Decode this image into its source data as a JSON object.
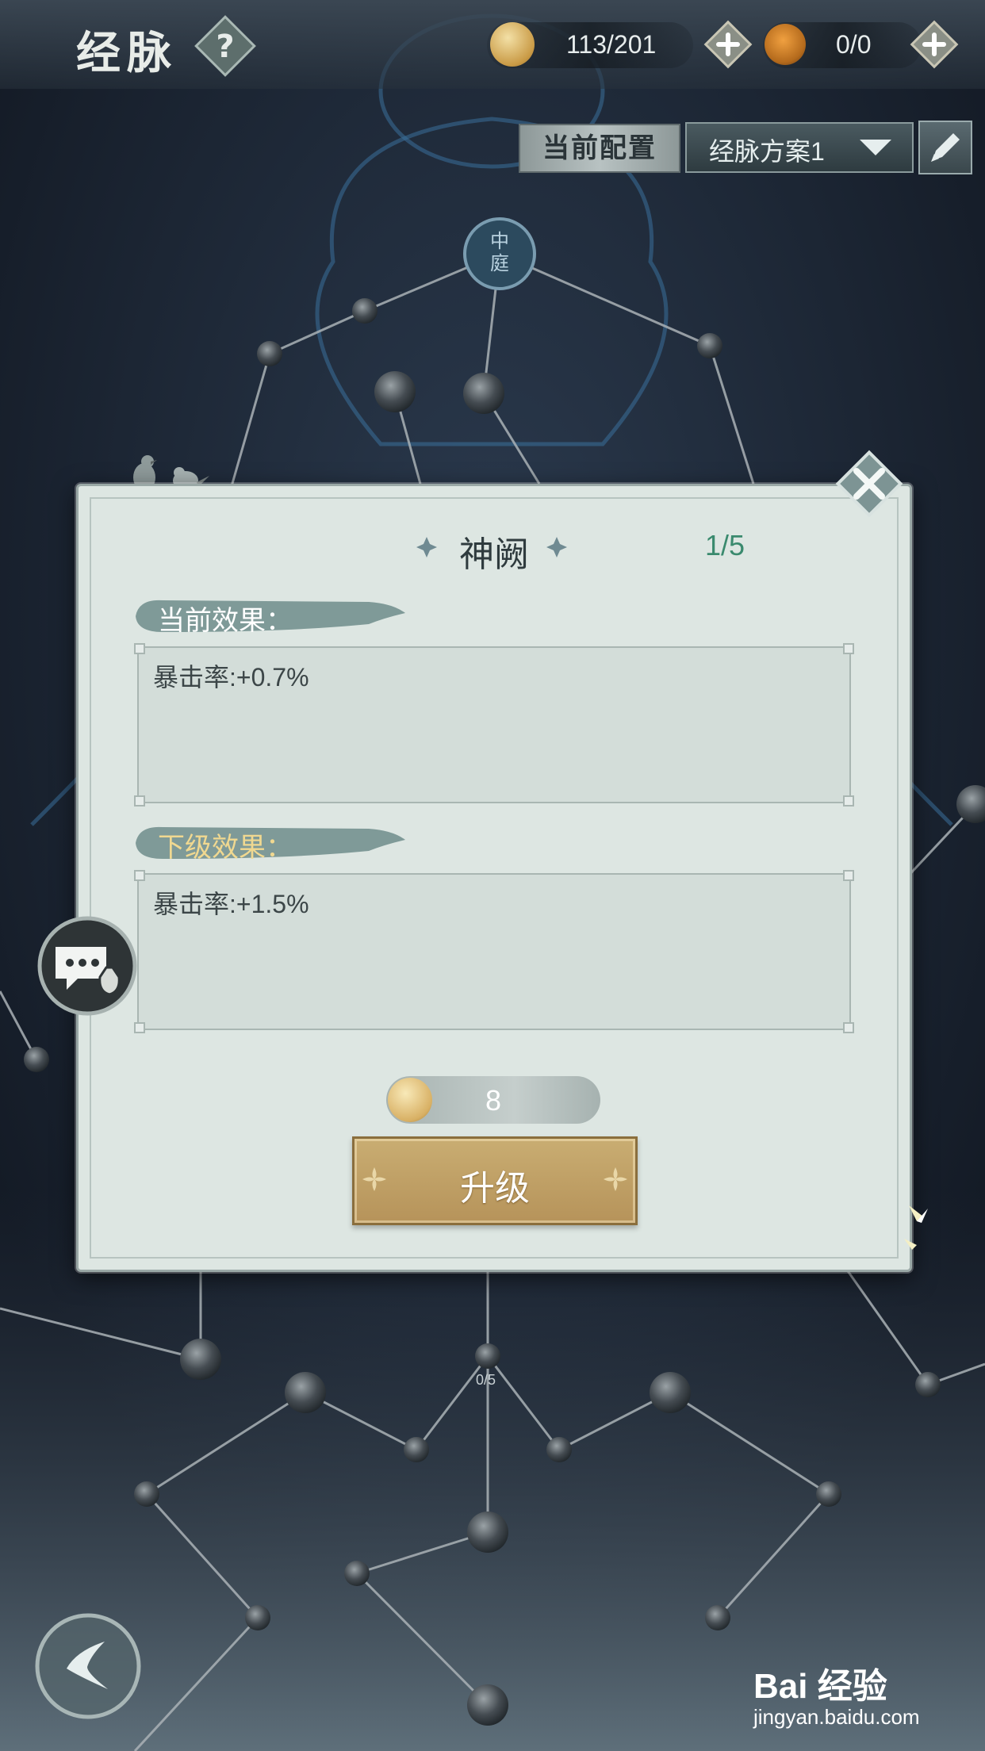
{
  "header": {
    "title": "经脉",
    "help_symbol": "?",
    "qi": {
      "icon_text": "元气",
      "value": "113/201"
    },
    "coin": {
      "value": "0/0"
    }
  },
  "config": {
    "label": "当前配置",
    "selected_plan": "经脉方案1"
  },
  "map": {
    "top_node_text": "中庭",
    "node_progress_label": "0/5"
  },
  "popup": {
    "skill_name": "神阙",
    "level": "1/5",
    "current_effect_label": "当前效果：",
    "current_effect_text": "暴击率:+0.7%",
    "next_effect_label": "下级效果：",
    "next_effect_text": "暴击率:+1.5%",
    "cost_icon_text": "元气",
    "cost_value": "8",
    "upgrade_label": "升级"
  },
  "watermark": {
    "brand": "Bai 经验",
    "url": "jingyan.baidu.com"
  },
  "colors": {
    "accent_green": "#3a8a6e",
    "next_effect_yellow": "#f0d890",
    "gold_button": "#c9ad72"
  }
}
